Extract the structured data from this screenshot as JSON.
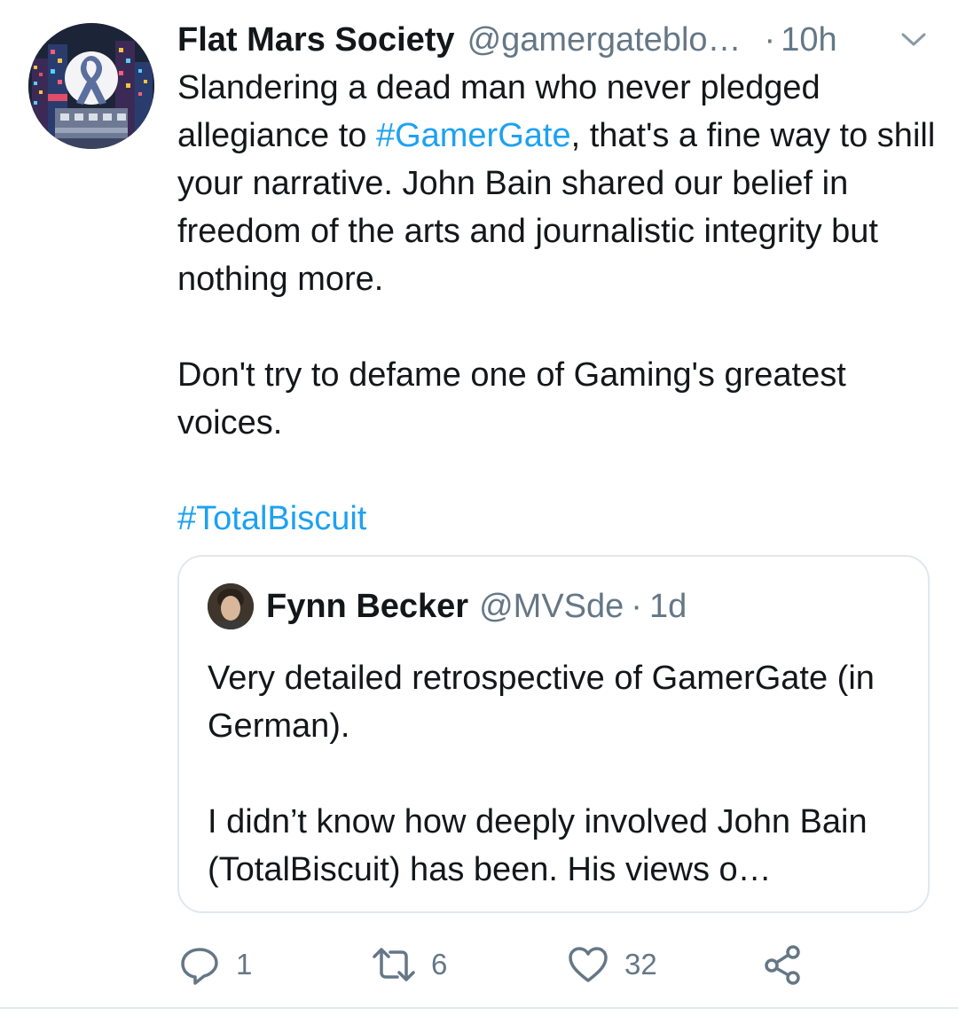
{
  "tweet": {
    "display_name": "Flat Mars Society",
    "handle": "@gamergateblo…",
    "dot": "·",
    "time": "10h",
    "paragraph1_a": "Slandering a dead man who never pledged allegiance to ",
    "hashtag1": "#GamerGate",
    "paragraph1_b": ", that's a fine way to shill your narrative. John Bain shared our belief in freedom of the arts and journalistic integrity but nothing more.",
    "paragraph2": "Don't try to defame one of Gaming's greatest voices.",
    "hashtag2": "#TotalBiscuit"
  },
  "quote": {
    "display_name": "Fynn Becker",
    "handle": "@MVSde",
    "dot": "·",
    "time": "1d",
    "paragraph1": "Very detailed retrospective of GamerGate (in German).",
    "paragraph2": "I didn’t know how deeply involved John Bain (TotalBiscuit) has been. His views o…"
  },
  "actions": {
    "reply_count": "1",
    "retweet_count": "6",
    "like_count": "32"
  },
  "icons": {
    "reply": "reply-icon",
    "retweet": "retweet-icon",
    "like": "heart-icon",
    "share": "share-icon",
    "menu": "chevron-down-icon"
  },
  "colors": {
    "hashtag": "#1da1f2",
    "secondary_text": "#657786",
    "border": "#e1e8ed"
  }
}
